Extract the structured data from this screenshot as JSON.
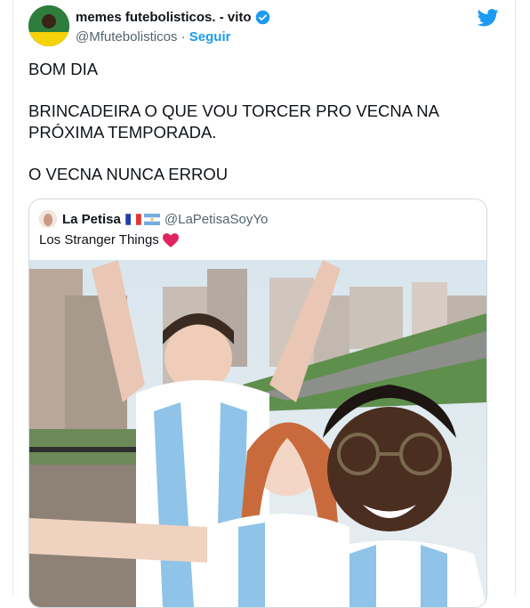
{
  "tweet": {
    "display_name": "memes futebolisticos. - vito",
    "handle": "@Mfutebolisticos",
    "separator": "·",
    "follow_label": "Seguir",
    "paragraphs": [
      "BOM DIA",
      "BRINCADEIRA O QUE VOU TORCER PRO VECNA NA PRÓXIMA TEMPORADA.",
      "O VECNA NUNCA ERROU"
    ]
  },
  "quoted": {
    "display_name": "La Petisa",
    "handle": "@LaPetisaSoyYo",
    "text": "Los Stranger Things"
  },
  "icons": {
    "brand": "twitter-bird-icon",
    "verified": "verified-badge-icon",
    "heart": "red-heart-icon",
    "flags": [
      "france-flag-icon",
      "argentina-flag-icon"
    ]
  },
  "colors": {
    "link": "#1d9bf0",
    "secondary_text": "#536471",
    "border": "#cfd9de"
  }
}
